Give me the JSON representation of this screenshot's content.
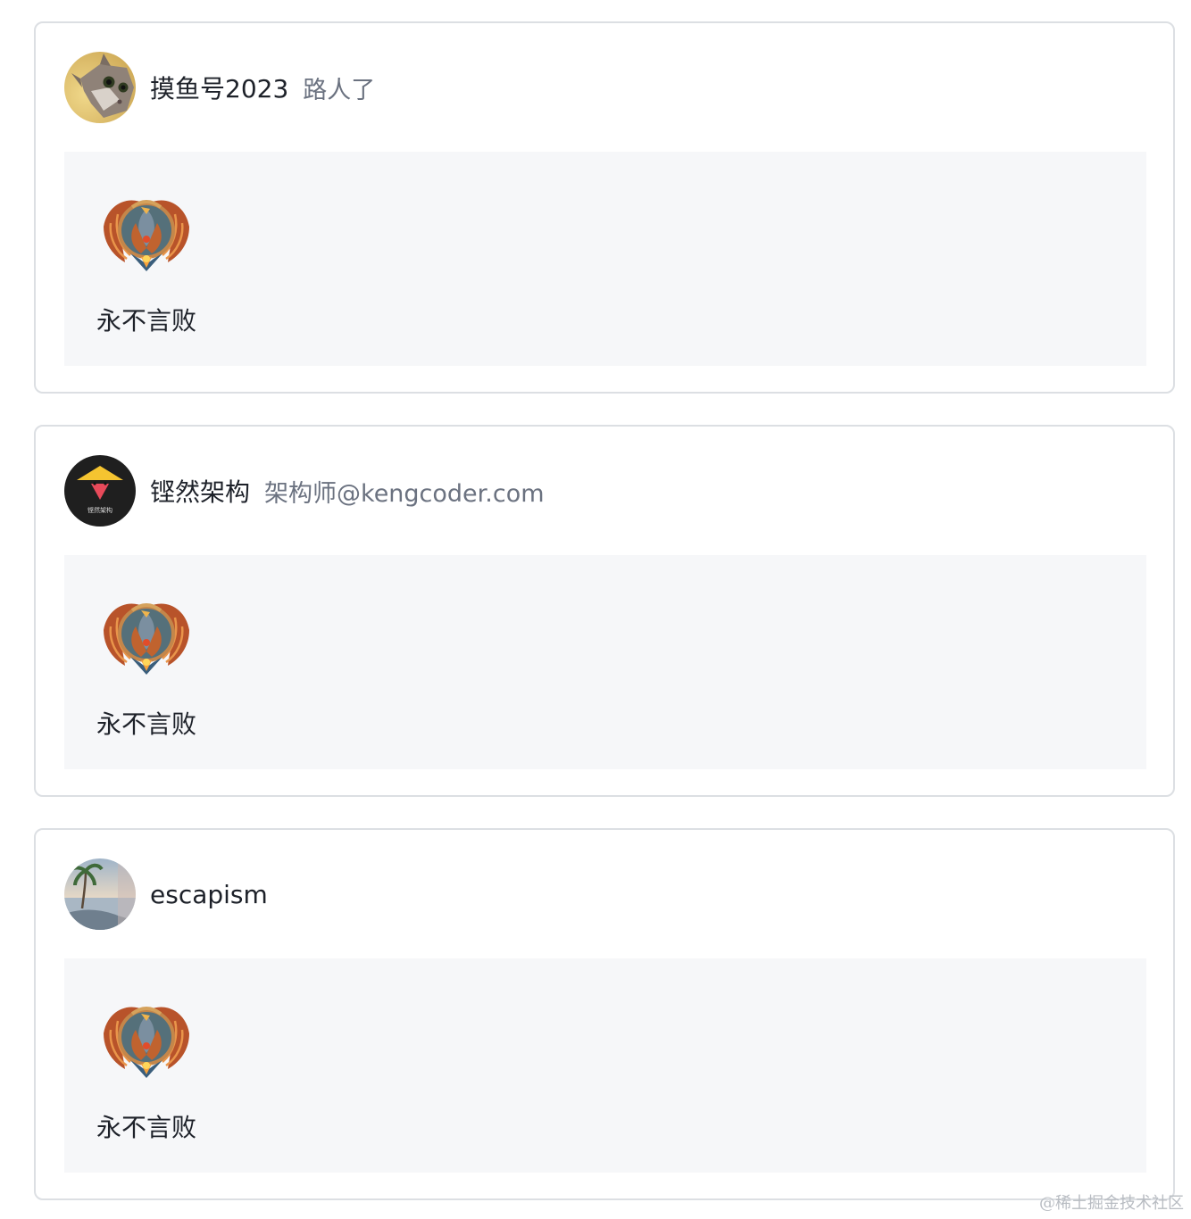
{
  "cards": [
    {
      "username": "摸鱼号2023",
      "title": "路人了",
      "avatar_icon": "cat-avatar-icon",
      "badge": {
        "icon": "phoenix-badge-icon",
        "name": "永不言败"
      }
    },
    {
      "username": "铿然架构",
      "title": "架构师@kengcoder.com",
      "avatar_icon": "kengcoder-logo-avatar-icon",
      "avatar_text": "铿然架构",
      "badge": {
        "icon": "phoenix-badge-icon",
        "name": "永不言败"
      }
    },
    {
      "username": "escapism",
      "title": "",
      "avatar_icon": "beach-palm-avatar-icon",
      "badge": {
        "icon": "phoenix-badge-icon",
        "name": "永不言败"
      }
    }
  ],
  "watermark": "@稀土掘金技术社区",
  "colors": {
    "card_border": "#dcdfe3",
    "panel_background": "#f6f7f9",
    "username_text": "#1d2129",
    "title_text": "#6b7280"
  }
}
